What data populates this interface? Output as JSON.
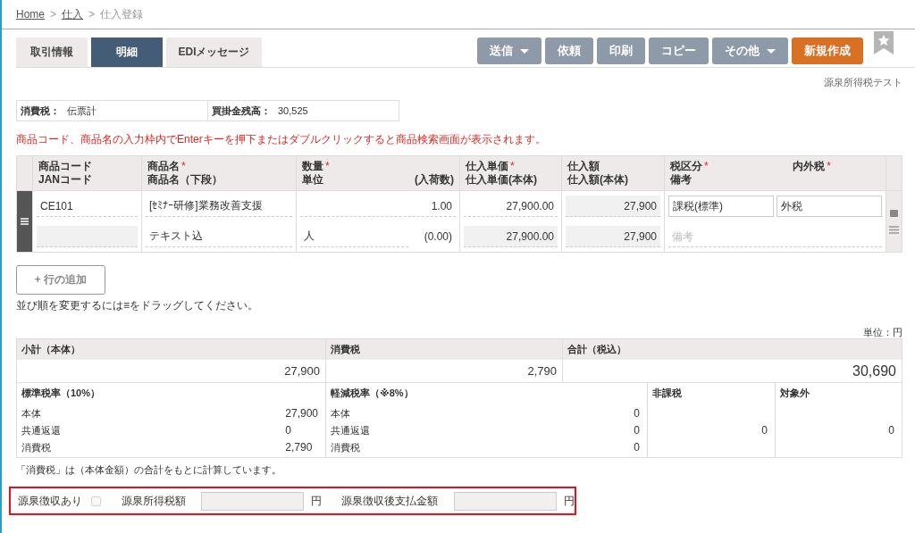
{
  "breadcrumb": [
    {
      "label": "Home",
      "kind": "link"
    },
    {
      "separator": ">",
      "label": "仕入",
      "kind": "link"
    },
    {
      "separator": ">",
      "label": "仕入登録",
      "kind": "current"
    }
  ],
  "tabs": [
    {
      "label": "取引情報",
      "selected": false
    },
    {
      "label": "明細",
      "selected": true
    },
    {
      "label": "EDIメッセージ",
      "selected": false
    }
  ],
  "actions": [
    {
      "label": "送信",
      "disabled": true,
      "dropdown": true
    },
    {
      "label": "依頼",
      "disabled": true,
      "dropdown": false
    },
    {
      "label": "印刷",
      "disabled": true,
      "dropdown": false
    },
    {
      "label": "コピー",
      "disabled": true,
      "dropdown": false
    },
    {
      "label": "その他",
      "disabled": true,
      "dropdown": true
    },
    {
      "label": "新規作成",
      "disabled": false,
      "dropdown": false
    }
  ],
  "company": "源泉所得税テスト",
  "info": [
    {
      "label": "消費税：",
      "value": "伝票計"
    },
    {
      "label": "買掛金残高：",
      "value": "30,525"
    }
  ],
  "notice": "商品コード、商品名の入力枠内でEnterキーを押下またはダブルクリックすると商品検索画面が表示されます。",
  "columns": [
    {
      "top": {
        "text": "商品コード"
      },
      "bottom": {
        "text": "JANコード"
      }
    },
    {
      "top": {
        "text": "商品名",
        "mark": "*"
      },
      "bottom": {
        "text": "商品名（下段）"
      }
    },
    {
      "top": {
        "text": "数量",
        "mark": "*"
      },
      "bottom": {
        "text": "単位"
      },
      "bottom_right": {
        "text": "(入荷数)"
      }
    },
    {
      "top": {
        "text": "仕入単価",
        "mark": "*"
      },
      "bottom": {
        "text": "仕入単価(本体)"
      }
    },
    {
      "top": {
        "text": "仕入額"
      },
      "bottom": {
        "text": "仕入額(本体)"
      }
    },
    {
      "top": {
        "text": "税区分",
        "mark": "*"
      },
      "bottom": {
        "text": "備考"
      },
      "top_right": {
        "text": "内外税",
        "mark": "*"
      }
    }
  ],
  "rows": [
    {
      "cells": [
        {
          "top": [
            {
              "kind": "text",
              "value": "CE101"
            }
          ],
          "bottom": [
            {
              "kind": "readonly"
            }
          ]
        },
        {
          "top": [
            {
              "kind": "text",
              "value": "[ｾﾐﾅｰ研修]業務改善支援"
            }
          ],
          "bottom": [
            {
              "kind": "text",
              "value": "テキスト込"
            }
          ]
        },
        {
          "top": [
            {
              "kind": "number",
              "value": "1.00"
            }
          ],
          "bottom": [
            {
              "kind": "text",
              "value": "人"
            },
            {
              "kind": "plain-number",
              "value": "(0.00)"
            }
          ]
        },
        {
          "top": [
            {
              "kind": "number",
              "value": "27,900.00"
            }
          ],
          "bottom": [
            {
              "kind": "readonly",
              "value": "27,900.00"
            }
          ]
        },
        {
          "top": [
            {
              "kind": "readonly",
              "value": "27,900"
            }
          ],
          "bottom": [
            {
              "kind": "readonly",
              "value": "27,900"
            }
          ]
        },
        {
          "top": [
            {
              "kind": "select",
              "value": "課税(標準)"
            },
            {
              "kind": "select",
              "value": "外税"
            }
          ],
          "bottom": [
            {
              "kind": "text",
              "placeholder": "備考"
            }
          ]
        }
      ]
    }
  ],
  "add_row": "+ 行の追加",
  "drag_hint": "並び順を変更するには≡をドラッグしてください。",
  "unit_label": "単位：円",
  "totals": [
    {
      "label": "小計（本体）",
      "value": "27,900",
      "kind": "normal"
    },
    {
      "label": "消費税",
      "value": "2,790",
      "kind": "normal"
    },
    {
      "label": "合計（税込）",
      "value": "30,690",
      "kind": "grand"
    }
  ],
  "breakdown": [
    {
      "label": "標準税率（10%）",
      "kind": "detail",
      "rows": [
        {
          "label": "本体",
          "value": "27,900"
        },
        {
          "label": "共通返還",
          "value": "0"
        },
        {
          "label": "消費税",
          "value": "2,790"
        }
      ]
    },
    {
      "label": "軽減税率（※8%）",
      "kind": "detail",
      "rows": [
        {
          "label": "本体",
          "value": "0"
        },
        {
          "label": "共通返還",
          "value": "0"
        },
        {
          "label": "消費税",
          "value": "0"
        }
      ]
    },
    {
      "label": "非課税",
      "kind": "single",
      "value": "0"
    },
    {
      "label": "対象外",
      "kind": "single",
      "value": "0"
    }
  ],
  "tax_note": "「消費税」は（本体金額）の合計をもとに計算しています。",
  "withholding": {
    "highlighted": true,
    "checkbox": {
      "label": "源泉徴収あり",
      "checked": false,
      "disabled": true
    },
    "fields": [
      {
        "label": "源泉所得税額",
        "unit": "円",
        "disabled": true
      },
      {
        "label": "源泉徴収後支払金額",
        "unit": "円",
        "disabled": true
      }
    ]
  }
}
